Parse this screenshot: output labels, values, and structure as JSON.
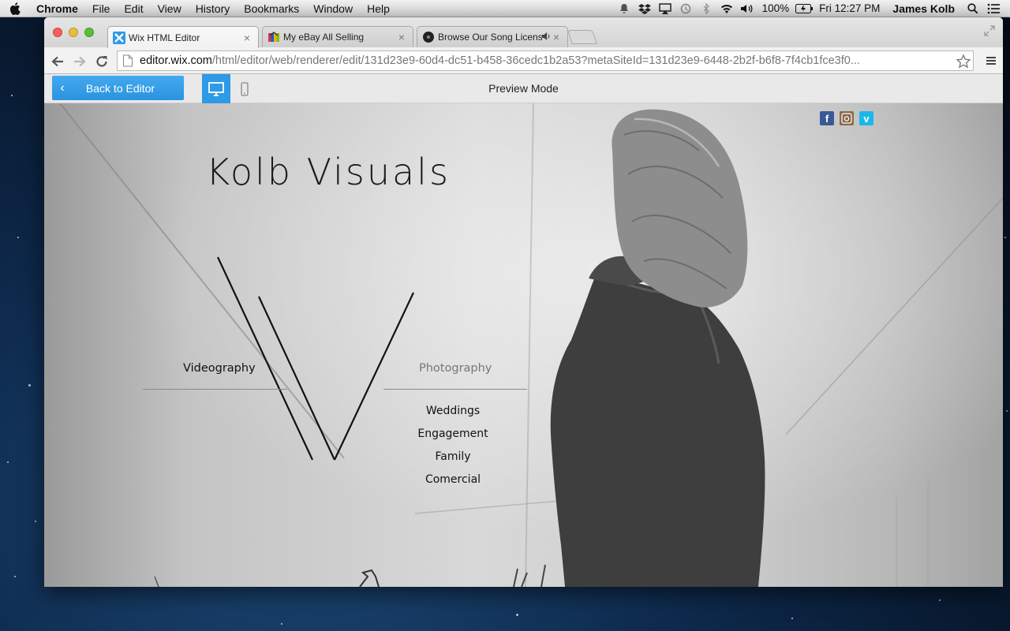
{
  "menubar": {
    "app_name": "Chrome",
    "menus": [
      "File",
      "Edit",
      "View",
      "History",
      "Bookmarks",
      "Window",
      "Help"
    ],
    "battery": "100%",
    "clock": "Fri 12:27 PM",
    "user": "James Kolb"
  },
  "browser": {
    "tabs": [
      {
        "title": "Wix HTML Editor",
        "active": true,
        "icon": "wix-icon"
      },
      {
        "title": "My eBay All Selling",
        "active": false,
        "icon": "ebay-icon"
      },
      {
        "title": "Browse Our Song Licens",
        "active": false,
        "icon": "music-icon",
        "playing_audio": true
      }
    ],
    "url_host": "editor.wix.com",
    "url_path": "/html/editor/web/renderer/edit/131d23e9-60d4-dc51-b458-36cedc1b2a53?metaSiteId=131d23e9-6448-2b2f-b6f8-7f4cb1fce3f0..."
  },
  "wix_bar": {
    "back_label": "Back to Editor",
    "mode_label": "Preview Mode"
  },
  "site": {
    "brand": "Kolb Visuals",
    "nav_left": "Videography",
    "nav_right": "Photography",
    "photography_items": [
      "Weddings",
      "Engagement",
      "Family",
      "Comercial"
    ],
    "social": [
      "facebook-icon",
      "instagram-icon",
      "vimeo-icon"
    ]
  },
  "colors": {
    "wix_blue": "#2f9ae6",
    "facebook": "#3b5998",
    "vimeo": "#1ab7ea"
  }
}
